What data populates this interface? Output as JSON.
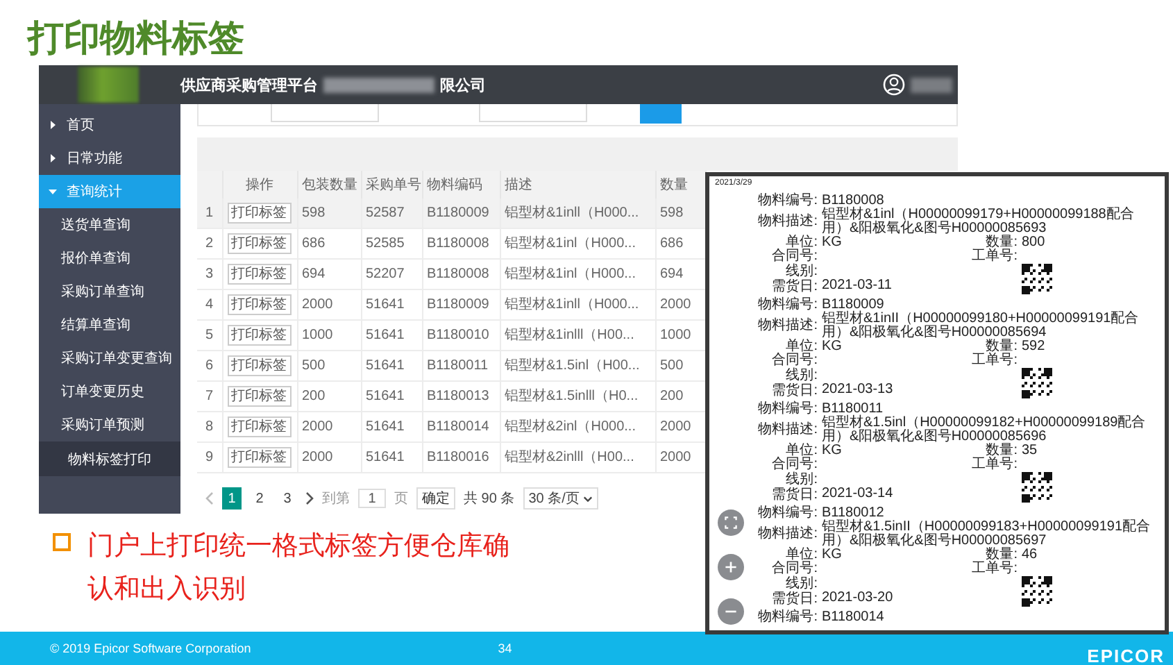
{
  "slide_title": "打印物料标签",
  "app": {
    "title": "供应商采购管理平台",
    "title_suffix": "限公司",
    "sidebar": [
      {
        "label": "首页",
        "expanded": false,
        "selected": false
      },
      {
        "label": "日常功能",
        "expanded": false,
        "selected": false
      },
      {
        "label": "查询统计",
        "expanded": true,
        "selected": true,
        "children": [
          {
            "label": "送货单查询",
            "selected": false
          },
          {
            "label": "报价单查询",
            "selected": false
          },
          {
            "label": "采购订单查询",
            "selected": false
          },
          {
            "label": "结算单查询",
            "selected": false
          },
          {
            "label": "采购订单变更查询",
            "selected": false
          },
          {
            "label": "订单变更历史",
            "selected": false
          },
          {
            "label": "采购订单预测",
            "selected": false
          },
          {
            "label": "物料标签打印",
            "selected": true
          }
        ]
      }
    ],
    "table": {
      "columns": [
        "操作",
        "包装数量",
        "采购单号",
        "物料编码",
        "描述",
        "数量"
      ],
      "rows": [
        {
          "index": "1",
          "action": "打印标签",
          "package_qty": "598",
          "po_no": "52587",
          "material_code": "B1180009",
          "description": "铝型材&1inll（H000...",
          "quantity": "598",
          "selected": true
        },
        {
          "index": "2",
          "action": "打印标签",
          "package_qty": "686",
          "po_no": "52585",
          "material_code": "B1180008",
          "description": "铝型材&1inl（H000...",
          "quantity": "686",
          "selected": false
        },
        {
          "index": "3",
          "action": "打印标签",
          "package_qty": "694",
          "po_no": "52207",
          "material_code": "B1180008",
          "description": "铝型材&1inl（H000...",
          "quantity": "694",
          "selected": false
        },
        {
          "index": "4",
          "action": "打印标签",
          "package_qty": "2000",
          "po_no": "51641",
          "material_code": "B1180009",
          "description": "铝型材&1inll（H000...",
          "quantity": "2000",
          "selected": false
        },
        {
          "index": "5",
          "action": "打印标签",
          "package_qty": "1000",
          "po_no": "51641",
          "material_code": "B1180010",
          "description": "铝型材&1inlll（H00...",
          "quantity": "1000",
          "selected": false
        },
        {
          "index": "6",
          "action": "打印标签",
          "package_qty": "500",
          "po_no": "51641",
          "material_code": "B1180011",
          "description": "铝型材&1.5inl（H00...",
          "quantity": "500",
          "selected": false
        },
        {
          "index": "7",
          "action": "打印标签",
          "package_qty": "200",
          "po_no": "51641",
          "material_code": "B1180013",
          "description": "铝型材&1.5inlll（H0...",
          "quantity": "200",
          "selected": false
        },
        {
          "index": "8",
          "action": "打印标签",
          "package_qty": "2000",
          "po_no": "51641",
          "material_code": "B1180014",
          "description": "铝型材&2inl（H000...",
          "quantity": "2000",
          "selected": false
        },
        {
          "index": "9",
          "action": "打印标签",
          "package_qty": "2000",
          "po_no": "51641",
          "material_code": "B1180016",
          "description": "铝型材&2inlll（H00...",
          "quantity": "2000",
          "selected": false
        }
      ]
    },
    "pagination": {
      "pages": [
        {
          "label": "1",
          "selected": true
        },
        {
          "label": "2",
          "selected": false
        },
        {
          "label": "3",
          "selected": false
        }
      ],
      "goto_label": "到第",
      "goto_value": "1",
      "page_unit": "页",
      "confirm": "确定",
      "total": "共 90 条",
      "page_size": "30 条/页"
    }
  },
  "preview": {
    "date": "2021/3/29",
    "labels": [
      {
        "code_label": "物料编号:",
        "code": "B1180008",
        "desc_label": "物料描述:",
        "desc": "铝型材&1inl（H00000099179+H00000099188配合用）&阳极氧化&图号H00000085693",
        "unit_label": "单位:",
        "unit": "KG",
        "qty_label": "数量:",
        "qty": "800",
        "contract_label": "合同号:",
        "order_label": "工单号:",
        "line_label": "线别:",
        "date_label": "需货日:",
        "date": "2021-03-11"
      },
      {
        "code_label": "物料编号:",
        "code": "B1180009",
        "desc_label": "物料描述:",
        "desc": "铝型材&1inII（H00000099180+H00000099191配合用）&阳极氧化&图号H00000085694",
        "unit_label": "单位:",
        "unit": "KG",
        "qty_label": "数量:",
        "qty": "592",
        "contract_label": "合同号:",
        "order_label": "工单号:",
        "line_label": "线别:",
        "date_label": "需货日:",
        "date": "2021-03-13"
      },
      {
        "code_label": "物料编号:",
        "code": "B1180011",
        "desc_label": "物料描述:",
        "desc": "铝型材&1.5inl（H00000099182+H00000099189配合用）&阳极氧化&图号H00000085696",
        "unit_label": "单位:",
        "unit": "KG",
        "qty_label": "数量:",
        "qty": "35",
        "contract_label": "合同号:",
        "order_label": "工单号:",
        "line_label": "线别:",
        "date_label": "需货日:",
        "date": "2021-03-14"
      },
      {
        "code_label": "物料编号:",
        "code": "B1180012",
        "desc_label": "物料描述:",
        "desc": "铝型材&1.5inII（H00000099183+H00000099191配合用）&阳极氧化&图号H00000085697",
        "unit_label": "单位:",
        "unit": "KG",
        "qty_label": "数量:",
        "qty": "46",
        "contract_label": "合同号:",
        "order_label": "工单号:",
        "line_label": "线别:",
        "date_label": "需货日:",
        "date": "2021-03-20"
      }
    ],
    "tail": {
      "code_label": "物料编号:",
      "code": "B1180014"
    }
  },
  "bullet": "门户上打印统一格式标签方便仓库确认和出入识别",
  "footer": {
    "copyright": "© 2019 Epicor Software Corporation",
    "page": "34",
    "logo": "EPICOR"
  }
}
